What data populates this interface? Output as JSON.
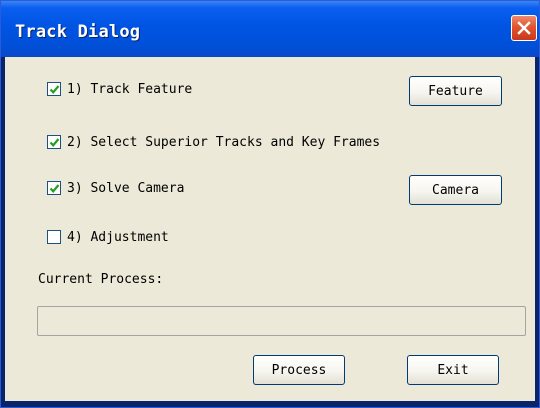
{
  "window": {
    "title": "Track Dialog"
  },
  "options": [
    {
      "label": "1) Track Feature",
      "checked": true
    },
    {
      "label": "2) Select Superior Tracks and Key Frames",
      "checked": true
    },
    {
      "label": "3) Solve Camera",
      "checked": true
    },
    {
      "label": "4) Adjustment",
      "checked": false
    }
  ],
  "buttons": {
    "feature": "Feature",
    "camera": "Camera",
    "process": "Process",
    "exit": "Exit"
  },
  "progress": {
    "label": "Current Process:",
    "fraction": 0
  },
  "icons": {
    "close": "close-icon",
    "check": "checkmark-icon"
  },
  "colors": {
    "titlebar": "#0054e3",
    "client": "#ece9d8",
    "close_button": "#e2552f",
    "check": "#21a121"
  }
}
